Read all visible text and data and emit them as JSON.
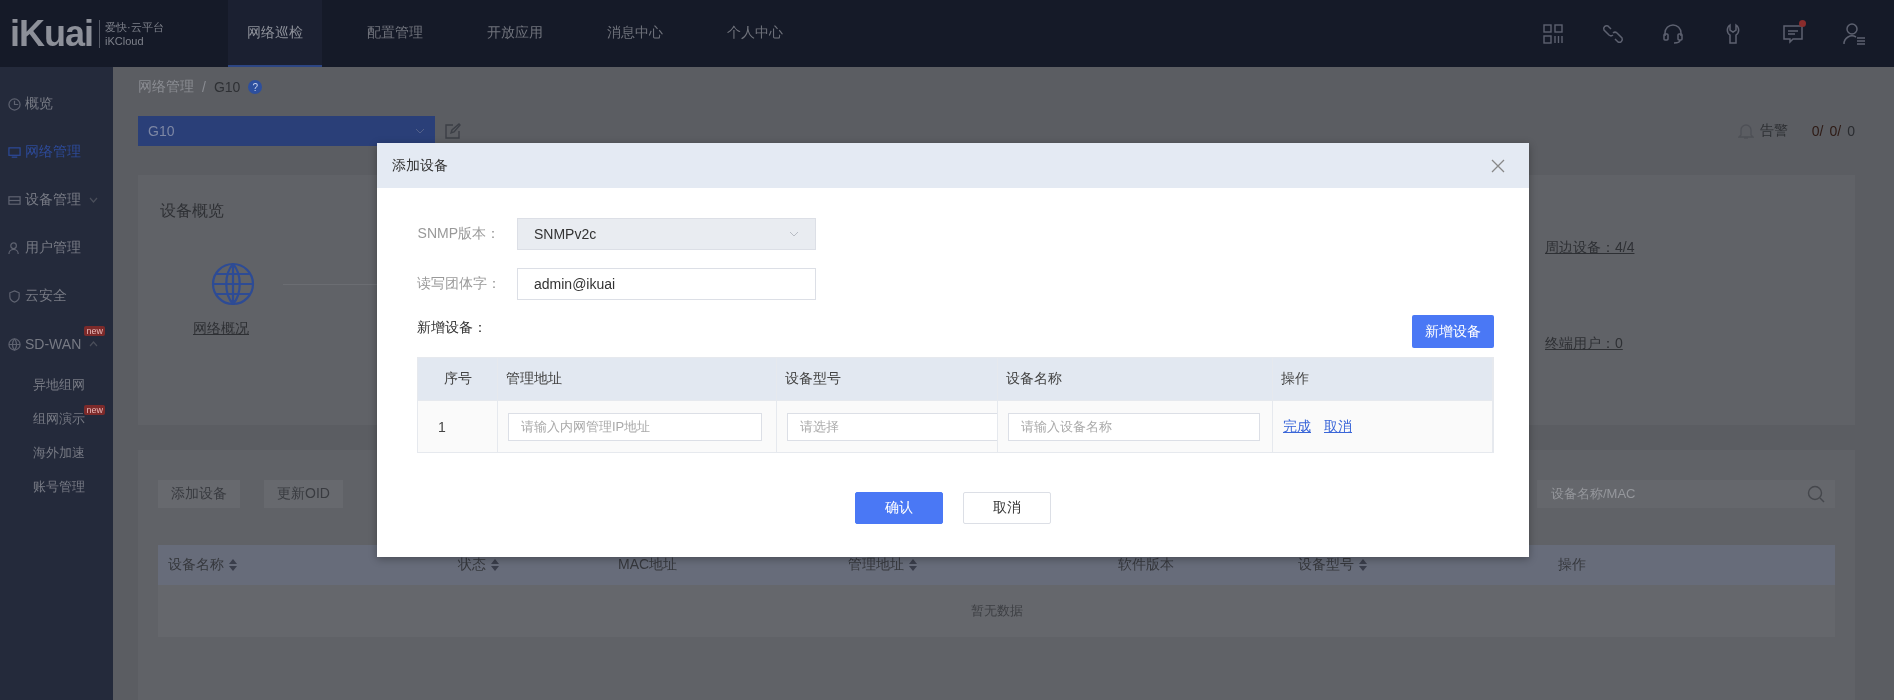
{
  "header": {
    "logo": "iKuai",
    "brand_name": "爱快·云平台",
    "brand_sub": "iKCloud",
    "tabs": [
      {
        "label": "网络巡检",
        "selected": true
      },
      {
        "label": "配置管理",
        "selected": false
      },
      {
        "label": "开放应用",
        "selected": false
      },
      {
        "label": "消息中心",
        "selected": false
      },
      {
        "label": "个人中心",
        "selected": false
      }
    ],
    "unread_messages": true
  },
  "sidebar": {
    "items": [
      {
        "label": "概览",
        "selected": false
      },
      {
        "label": "网络管理",
        "selected": true
      },
      {
        "label": "设备管理",
        "selected": false,
        "expanded": false
      },
      {
        "label": "用户管理",
        "selected": false
      },
      {
        "label": "云安全",
        "selected": false
      },
      {
        "label": "SD-WAN",
        "selected": false,
        "expanded": true,
        "badge": "new",
        "children": [
          {
            "label": "异地组网",
            "selected": false
          },
          {
            "label": "组网演示",
            "selected": false,
            "badge": "new"
          },
          {
            "label": "海外加速",
            "selected": false
          },
          {
            "label": "账号管理",
            "selected": false
          }
        ]
      }
    ]
  },
  "breadcrumb": [
    "网络管理",
    "/",
    "G10"
  ],
  "help_icon": "?",
  "device_select": {
    "value": "G10"
  },
  "alerts": {
    "label": "告警",
    "counts": [
      {
        "text": "0/",
        "color": "#2e1a14"
      },
      {
        "text": "0/",
        "color": "#2e1a14"
      },
      {
        "text": "0",
        "color": "#2a2c30"
      }
    ]
  },
  "overview": {
    "title": "设备概览",
    "network_link": "网络概况",
    "peripheral_link": "周边设备：4/4",
    "terminal_link": "终端用户：0"
  },
  "device_list": {
    "buttons": [
      "添加设备",
      "更新OID"
    ],
    "search": {
      "placeholder": "设备名称/MAC"
    },
    "columns": [
      {
        "label": "设备名称",
        "sortable": true
      },
      {
        "label": "状态",
        "sortable": true
      },
      {
        "label": "MAC地址",
        "sortable": false
      },
      {
        "label": "管理地址",
        "sortable": true
      },
      {
        "label": "软件版本",
        "sortable": false
      },
      {
        "label": "设备型号",
        "sortable": true
      },
      {
        "label": "操作",
        "sortable": false
      }
    ],
    "empty_text": "暂无数据"
  },
  "modal": {
    "title": "添加设备",
    "fields": [
      {
        "label": "SNMP版本：",
        "kind": "select",
        "value": "SNMPv2c",
        "disabled": true
      },
      {
        "label": "读写团体字：",
        "kind": "text",
        "value": "admin@ikuai",
        "disabled": false
      }
    ],
    "section_label": "新增设备：",
    "add_button": "新增设备",
    "table": {
      "columns": [
        "序号",
        "管理地址",
        "设备型号",
        "设备名称",
        "操作"
      ],
      "rows": [
        {
          "index": "1",
          "address": {
            "placeholder": "请输入内网管理IP地址"
          },
          "model": {
            "placeholder": "请选择"
          },
          "name": {
            "placeholder": "请输入设备名称"
          },
          "actions": [
            "完成",
            "取消"
          ]
        }
      ]
    },
    "buttons": [
      {
        "label": "确认",
        "primary": true
      },
      {
        "label": "取消",
        "primary": false
      }
    ]
  }
}
